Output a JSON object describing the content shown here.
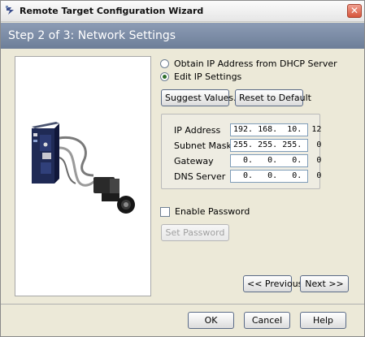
{
  "window": {
    "title": "Remote Target Configuration Wizard",
    "close_symbol": "✕"
  },
  "header": {
    "step_title": "Step 2 of 3: Network Settings"
  },
  "ip_mode": {
    "options": [
      {
        "label": "Obtain IP Address from DHCP Server",
        "selected": false
      },
      {
        "label": "Edit IP Settings",
        "selected": true
      }
    ]
  },
  "buttons": {
    "suggest": "Suggest Values...",
    "reset": "Reset to Default",
    "set_password": "Set Password",
    "previous": "<< Previous",
    "next": "Next >>",
    "ok": "OK",
    "cancel": "Cancel",
    "help": "Help"
  },
  "network": {
    "fields": [
      {
        "label": "IP Address",
        "value": "192. 168.  10.  12"
      },
      {
        "label": "Subnet Mask",
        "value": "255. 255. 255.   0"
      },
      {
        "label": "Gateway",
        "value": "  0.   0.   0.   0"
      },
      {
        "label": "DNS Server",
        "value": "  0.   0.   0.   0"
      }
    ]
  },
  "password": {
    "enable_label": "Enable Password",
    "enabled": false
  },
  "icons": {
    "title": "wizard-icon",
    "close": "close-icon",
    "device": "smart-camera-device-illustration"
  },
  "colors": {
    "header_bg": "#7b8aa5",
    "window_bg": "#ece9d8",
    "close_btn": "#d6553b"
  }
}
